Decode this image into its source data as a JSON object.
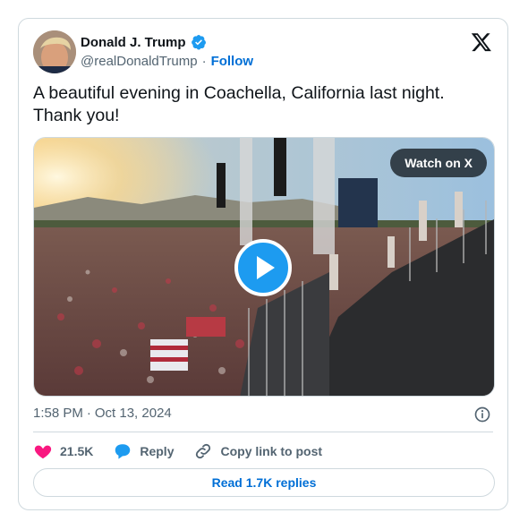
{
  "author": {
    "display_name": "Donald J. Trump",
    "handle": "@realDonaldTrump",
    "separator": "·",
    "follow_label": "Follow",
    "verified_icon": "verified-badge-icon",
    "avatar_icon": "avatar"
  },
  "tweet": {
    "text_line1": "A beautiful evening in Coachella, California last night.",
    "text_line2": "Thank you!"
  },
  "media": {
    "watch_label": "Watch on X",
    "play_icon": "play-icon"
  },
  "meta": {
    "time": "1:58 PM",
    "separator": "·",
    "date": "Oct 13, 2024"
  },
  "actions": {
    "like_count": "21.5K",
    "reply_label": "Reply",
    "copy_label": "Copy link to post"
  },
  "replies": {
    "label": "Read 1.7K replies"
  },
  "colors": {
    "link": "#006fd6",
    "like": "#f91880",
    "verified": "#1d9bf0",
    "muted": "#536471",
    "border": "#cfd9de"
  }
}
